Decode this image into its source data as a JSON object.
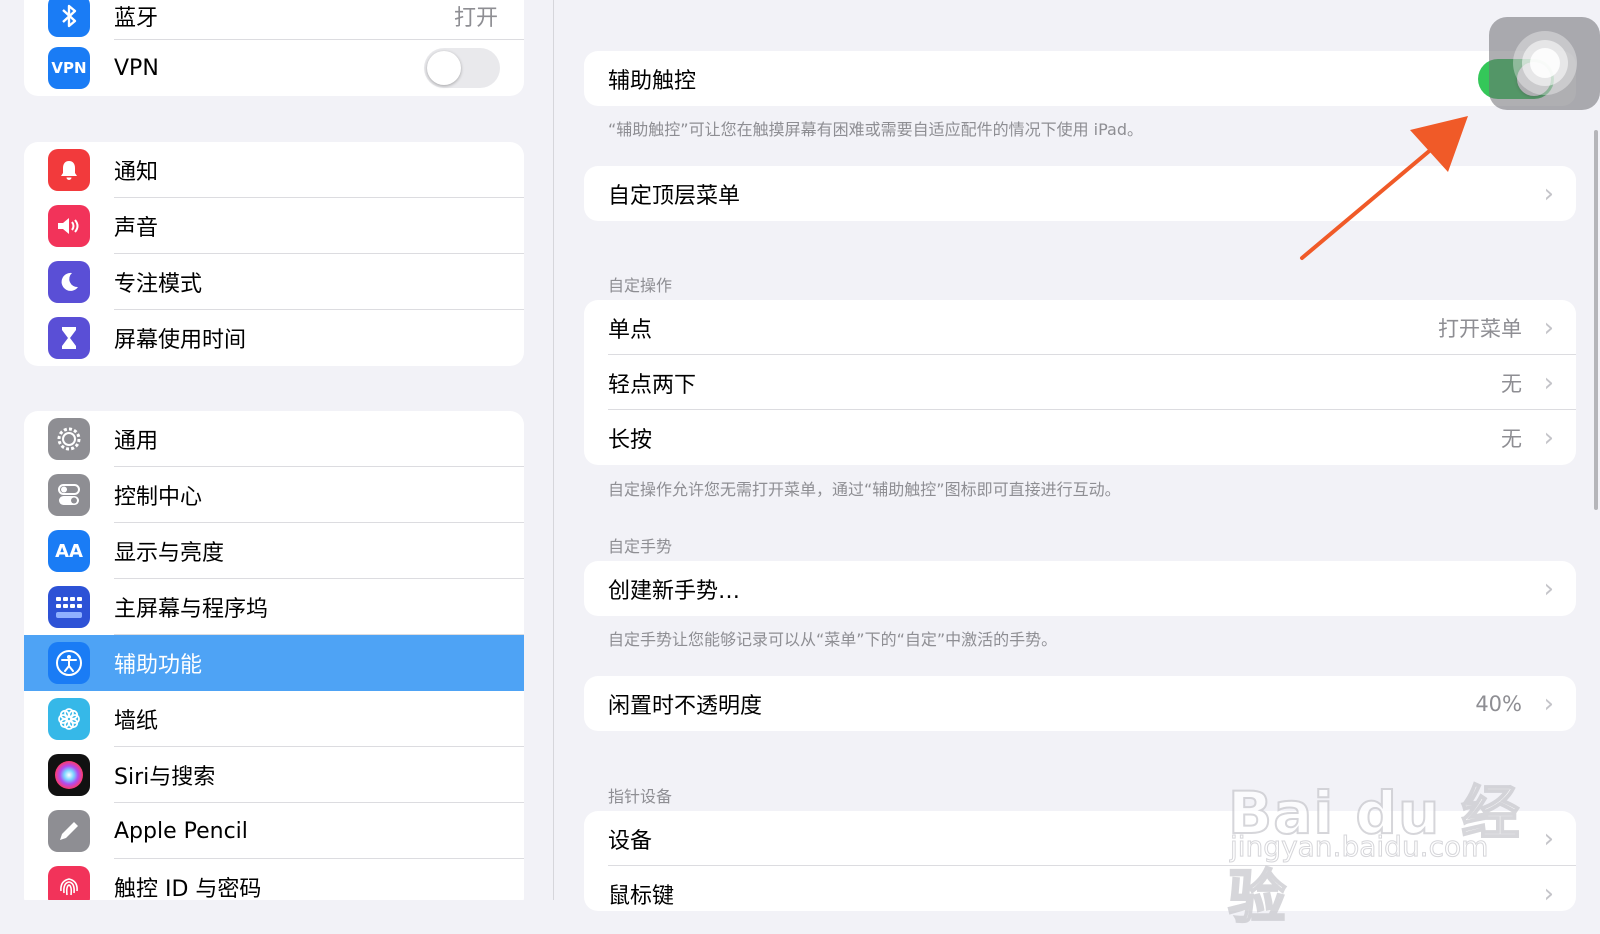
{
  "sidebar": {
    "group1": [
      {
        "label": "蓝牙",
        "value": "打开",
        "icon": "bluetooth-icon",
        "color": "#1a7cf5"
      },
      {
        "label": "VPN",
        "icon_text": "VPN",
        "icon": "vpn-icon",
        "color": "#1a7cf5",
        "toggle": false
      }
    ],
    "group2": [
      {
        "label": "通知",
        "icon": "bell-icon",
        "color": "#f23a3c",
        "glyph": "🔔"
      },
      {
        "label": "声音",
        "icon": "speaker-icon",
        "color": "#f2335a",
        "glyph": "🔊"
      },
      {
        "label": "专注模式",
        "icon": "moon-icon",
        "color": "#5a4fd6",
        "glyph": "☾"
      },
      {
        "label": "屏幕使用时间",
        "icon": "hourglass-icon",
        "color": "#5a4fd6",
        "glyph": "⧗"
      }
    ],
    "group3": [
      {
        "label": "通用",
        "icon": "gear-icon",
        "color": "#8e8e93",
        "glyph": "⚙"
      },
      {
        "label": "控制中心",
        "icon": "switches-icon",
        "color": "#8e8e93",
        "glyph": "☷"
      },
      {
        "label": "显示与亮度",
        "icon": "text-size-icon",
        "color": "#1a7cf5",
        "glyph": "AA"
      },
      {
        "label": "主屏幕与程序坞",
        "icon": "home-grid-icon",
        "color": "#2d52d6",
        "glyph": "▦"
      },
      {
        "label": "辅助功能",
        "icon": "accessibility-icon",
        "color": "#1a7cf5",
        "glyph": "♿",
        "active": true
      },
      {
        "label": "墙纸",
        "icon": "flower-icon",
        "color": "#36b8e8",
        "glyph": "✿"
      },
      {
        "label": "Siri与搜索",
        "icon": "siri-icon",
        "color": "#222222",
        "glyph": "◉"
      },
      {
        "label": "Apple Pencil",
        "icon": "pencil-icon",
        "color": "#8e8e93",
        "glyph": "✎"
      },
      {
        "label": "触控 ID 与密码",
        "icon": "fingerprint-icon",
        "color": "#f2335a",
        "glyph": "◎"
      }
    ]
  },
  "detail": {
    "assistive_touch": {
      "label": "辅助触控",
      "toggle": true
    },
    "assistive_note": "“辅助触控”可让您在触摸屏幕有困难或需要自适应配件的情况下使用 iPad。",
    "customize_top_menu": "自定顶层菜单",
    "custom_actions_header": "自定操作",
    "custom_actions": [
      {
        "label": "单点",
        "value": "打开菜单"
      },
      {
        "label": "轻点两下",
        "value": "无"
      },
      {
        "label": "长按",
        "value": "无"
      }
    ],
    "custom_actions_note": "自定操作允许您无需打开菜单，通过“辅助触控”图标即可直接进行互动。",
    "custom_gestures_header": "自定手势",
    "create_gesture": "创建新手势…",
    "custom_gestures_note": "自定手势让您能够记录可以从“菜单”下的“自定”中激活的手势。",
    "idle_opacity": {
      "label": "闲置时不透明度",
      "value": "40%"
    },
    "pointer_header": "指针设备",
    "pointer_items": [
      {
        "label": "设备"
      },
      {
        "label": "鼠标键"
      }
    ]
  },
  "watermark": {
    "brand": "Bai du 经验",
    "url": "jingyan.baidu.com"
  },
  "colors": {
    "accent": "#4ea3f5",
    "toggle_on": "#34c759",
    "arrow": "#f05a28"
  }
}
